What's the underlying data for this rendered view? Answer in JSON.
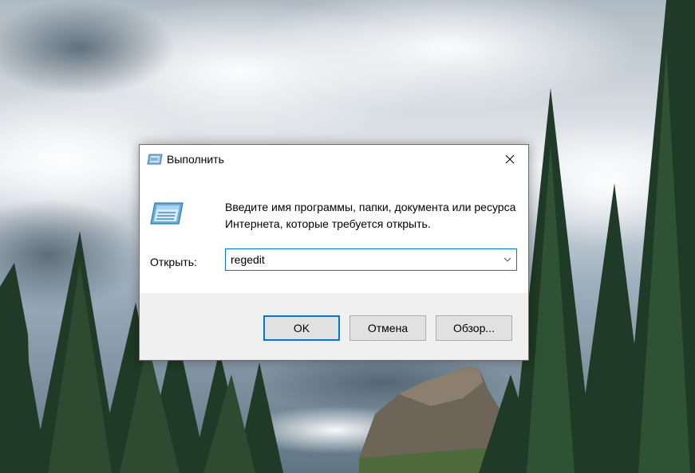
{
  "dialog": {
    "title": "Выполнить",
    "prompt": "Введите имя программы, папки, документа или ресурса Интернета, которые требуется открыть.",
    "open_label": "Открыть:",
    "input_value": "regedit",
    "buttons": {
      "ok": "OK",
      "cancel": "Отмена",
      "browse": "Обзор..."
    }
  },
  "icons": {
    "title": "run-icon",
    "close": "close-icon",
    "dropdown": "chevron-down-icon",
    "main": "run-icon"
  },
  "colors": {
    "accent": "#0078d7",
    "footer_bg": "#f0f0f0",
    "button_bg": "#e1e1e1"
  }
}
